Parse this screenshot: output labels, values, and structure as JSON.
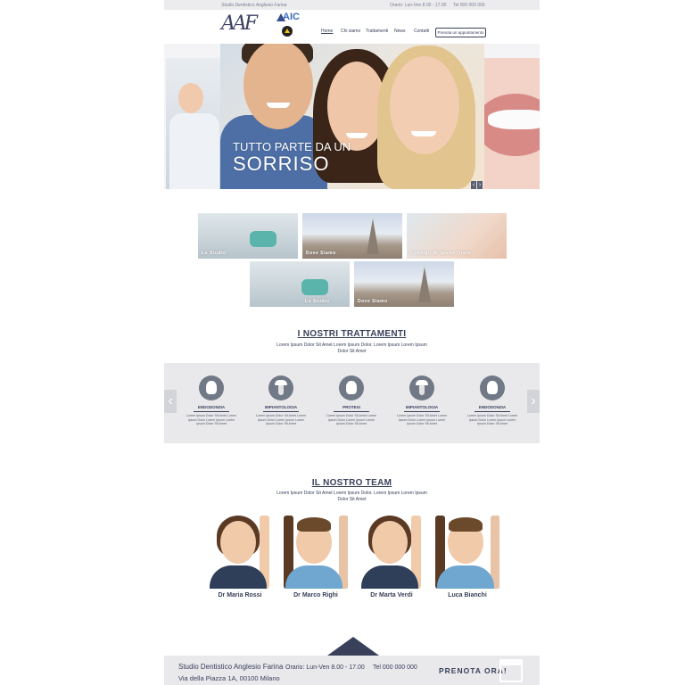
{
  "topbar": {
    "studio_name": "Studio Dentistico Anglesio Farina",
    "hours": "Orario: Lun-Ven 8.00 - 17.00",
    "phone": "Tel 000 000 000"
  },
  "header": {
    "logo_text": "AAF",
    "partner_logo_text": "AIC",
    "nav": [
      "Home",
      "Chi siamo",
      "Trattamenti",
      "News",
      "Contatti"
    ],
    "cta": "Prenota un appuntamento"
  },
  "hero": {
    "line1": "TUTTO PARTE DA UN",
    "line2": "SORRISO",
    "prev_icon": "chevron-left-icon",
    "next_icon": "chevron-right-icon",
    "prev_glyph": "‹",
    "next_glyph": "›"
  },
  "gallery": [
    {
      "label": "Lo Studio"
    },
    {
      "label": "Dove Siamo"
    },
    {
      "label": "Consigli di Igiene Orale"
    },
    {
      "label": "Lo Studio"
    },
    {
      "label": "Dove Siamo"
    }
  ],
  "treatments": {
    "title": "I NOSTRI TRATTAMENTI",
    "subtitle": "Lorem Ipsum Dolor Sit Amet Lorem Ipsum Dolor. Lorem Ipsum Lorem Ipsum Dolor Sit Amet",
    "prev_glyph": "‹",
    "next_glyph": "›",
    "items": [
      {
        "name": "ENDODONZIA",
        "icon": "tooth-icon",
        "desc": "Lorem Ipsum Dolor Sit Amet Lorem Ipsum Dolor Lorem Ipsum Lorem Ipsum Dolor Sit Amet"
      },
      {
        "name": "IMPIANTOLOGIA",
        "icon": "dental-implant-icon",
        "desc": "Lorem Ipsum Dolor Sit Amet Lorem Ipsum Dolor Lorem Ipsum Lorem Ipsum Dolor Sit Amet"
      },
      {
        "name": "PROTESI",
        "icon": "tooth-icon",
        "desc": "Lorem Ipsum Dolor Sit Amet Lorem Ipsum Dolor Lorem Ipsum Lorem Ipsum Dolor Sit Amet"
      },
      {
        "name": "IMPIANTOLOGIA",
        "icon": "dental-implant-icon",
        "desc": "Lorem Ipsum Dolor Sit Amet Lorem Ipsum Dolor Lorem Ipsum Lorem Ipsum Dolor Sit Amet"
      },
      {
        "name": "ENDODONZIA",
        "icon": "tooth-icon",
        "desc": "Lorem Ipsum Dolor Sit Amet Lorem Ipsum Dolor Lorem Ipsum Lorem Ipsum Dolor Sit Amet"
      }
    ]
  },
  "team": {
    "title": "IL NOSTRO TEAM",
    "subtitle": "Lorem Ipsum Dolor Sit Amet Lorem Ipsum Dolor. Lorem Ipsum Lorem Ipsum Dolor Sit Amet",
    "members": [
      {
        "name": "Dr Maria Rossi"
      },
      {
        "name": "Dr Marco Righi"
      },
      {
        "name": "Dr Marta Verdi"
      },
      {
        "name": "Luca Bianchi"
      }
    ]
  },
  "footer": {
    "studio_name": "Studio Dentistico Anglesio Farina",
    "address": "Via della Piazza 1A, 00100 Milano",
    "hours": "Orario: Lun-Ven 8.00 - 17.00",
    "phone": "Tel 000 000 000",
    "cta": "PRENOTA ORA!",
    "cta_icon": "calendar-icon"
  },
  "colors": {
    "brand_navy": "#39405a",
    "band_grey": "#e9e9ec",
    "icon_grey": "#717886"
  }
}
